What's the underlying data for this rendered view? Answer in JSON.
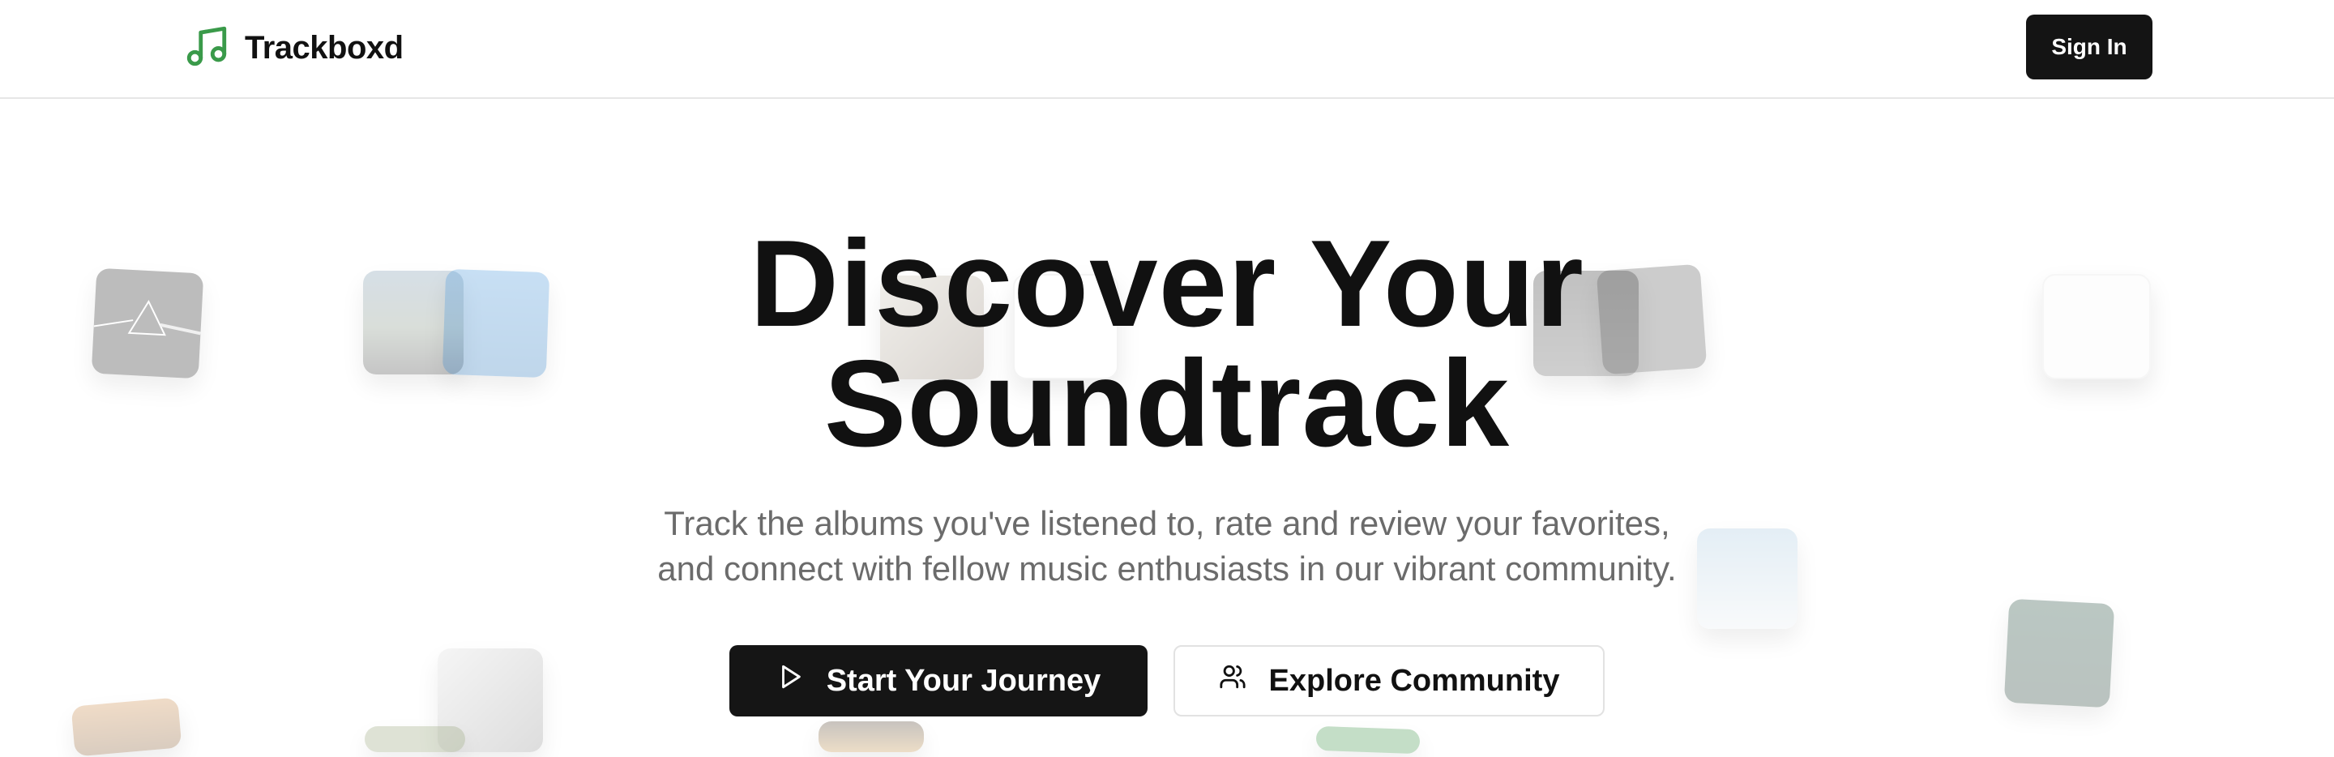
{
  "header": {
    "brand": "Trackboxd",
    "sign_in_label": "Sign In"
  },
  "hero": {
    "title_line1": "Discover Your",
    "title_line2": "Soundtrack",
    "subtitle_line1": "Track the albums you've listened to, rate and review your favorites,",
    "subtitle_line2": "and connect with fellow music enthusiasts in our vibrant community.",
    "primary_cta": "Start Your Journey",
    "secondary_cta": "Explore Community"
  },
  "colors": {
    "brand_icon": "#3a9a4a",
    "primary_button": "#151515",
    "subtitle_text": "#6b6b6b"
  },
  "icons": {
    "logo": "music-note-icon",
    "primary_cta": "play-icon",
    "secondary_cta": "users-icon"
  }
}
